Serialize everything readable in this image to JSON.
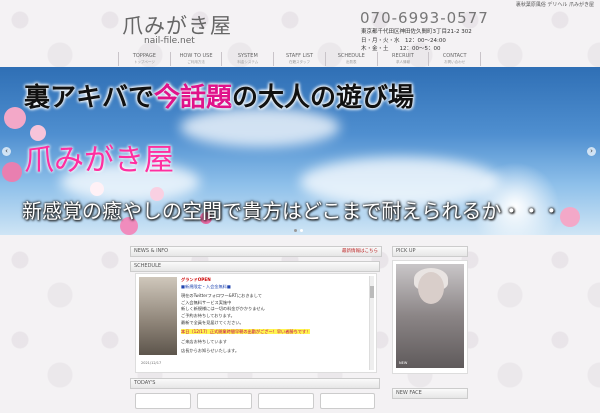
{
  "header": {
    "top_note": "裏秋葉原風俗 デリヘル 爪みがき屋",
    "logo_text": "爪みがき屋",
    "logo_domain": "nail-file.net",
    "phone": "070-6993-0577",
    "address_lines": [
      "東京都千代田区神田佐久間町3丁目21-2 302",
      "日・月・火・水　12：00〜24:00",
      "木・金・土　　12：00〜5：00"
    ]
  },
  "nav": {
    "items": [
      {
        "label": "TOPPAGE",
        "sub": "トップページ"
      },
      {
        "label": "HOW TO USE",
        "sub": "ご利用方法"
      },
      {
        "label": "SYSTEM",
        "sub": "料金システム"
      },
      {
        "label": "STAFF LIST",
        "sub": "在籍スタッフ"
      },
      {
        "label": "SCHEDULE",
        "sub": "出勤表"
      },
      {
        "label": "RECRUIT",
        "sub": "求人情報"
      },
      {
        "label": "CONTACT",
        "sub": "お問い合わせ"
      }
    ]
  },
  "hero": {
    "line1_pre": "裏アキバで",
    "line1_highlight": "今話題",
    "line1_post": "の大人の遊び場",
    "line2": "爪みがき屋",
    "line3": "新感覚の癒やしの空間で貴方はどこまで耐えられるか・・・",
    "prev_symbol": "‹",
    "next_symbol": "›",
    "slides": 2,
    "active_slide": 1
  },
  "main": {
    "news_bar_label": "NEWS & INFO",
    "news_bar_right": "最新情報はこちら",
    "schedule_bar_label": "SCHEDULE",
    "schedule": {
      "open_title": "グランドOPEN",
      "line_a": "■新規限定・入会金無料■",
      "line_b": "現在のTwitterフォロワー&RTにおきまして",
      "line_c": "ご入会無料サービス実施中",
      "line_d": "新しく新規様には一切の料金がかかりません",
      "line_e": "ご予約お待ちしております。",
      "line_f": "最新で全員を見届けてください。",
      "highlight": "本日（12/17）正式開業時間早朝の出勤がござー！早い者勝ちです！",
      "line_g": "ご来店お待ちしています",
      "line_h": "店長からお知らせいたします。",
      "photo_caption": "2021/12/17"
    },
    "today_bar_label": "TODAY'S"
  },
  "side": {
    "pickup_bar_label": "PICK UP",
    "pickup_caption": "NEW",
    "bottom_bar_label": "NEW FACE"
  }
}
